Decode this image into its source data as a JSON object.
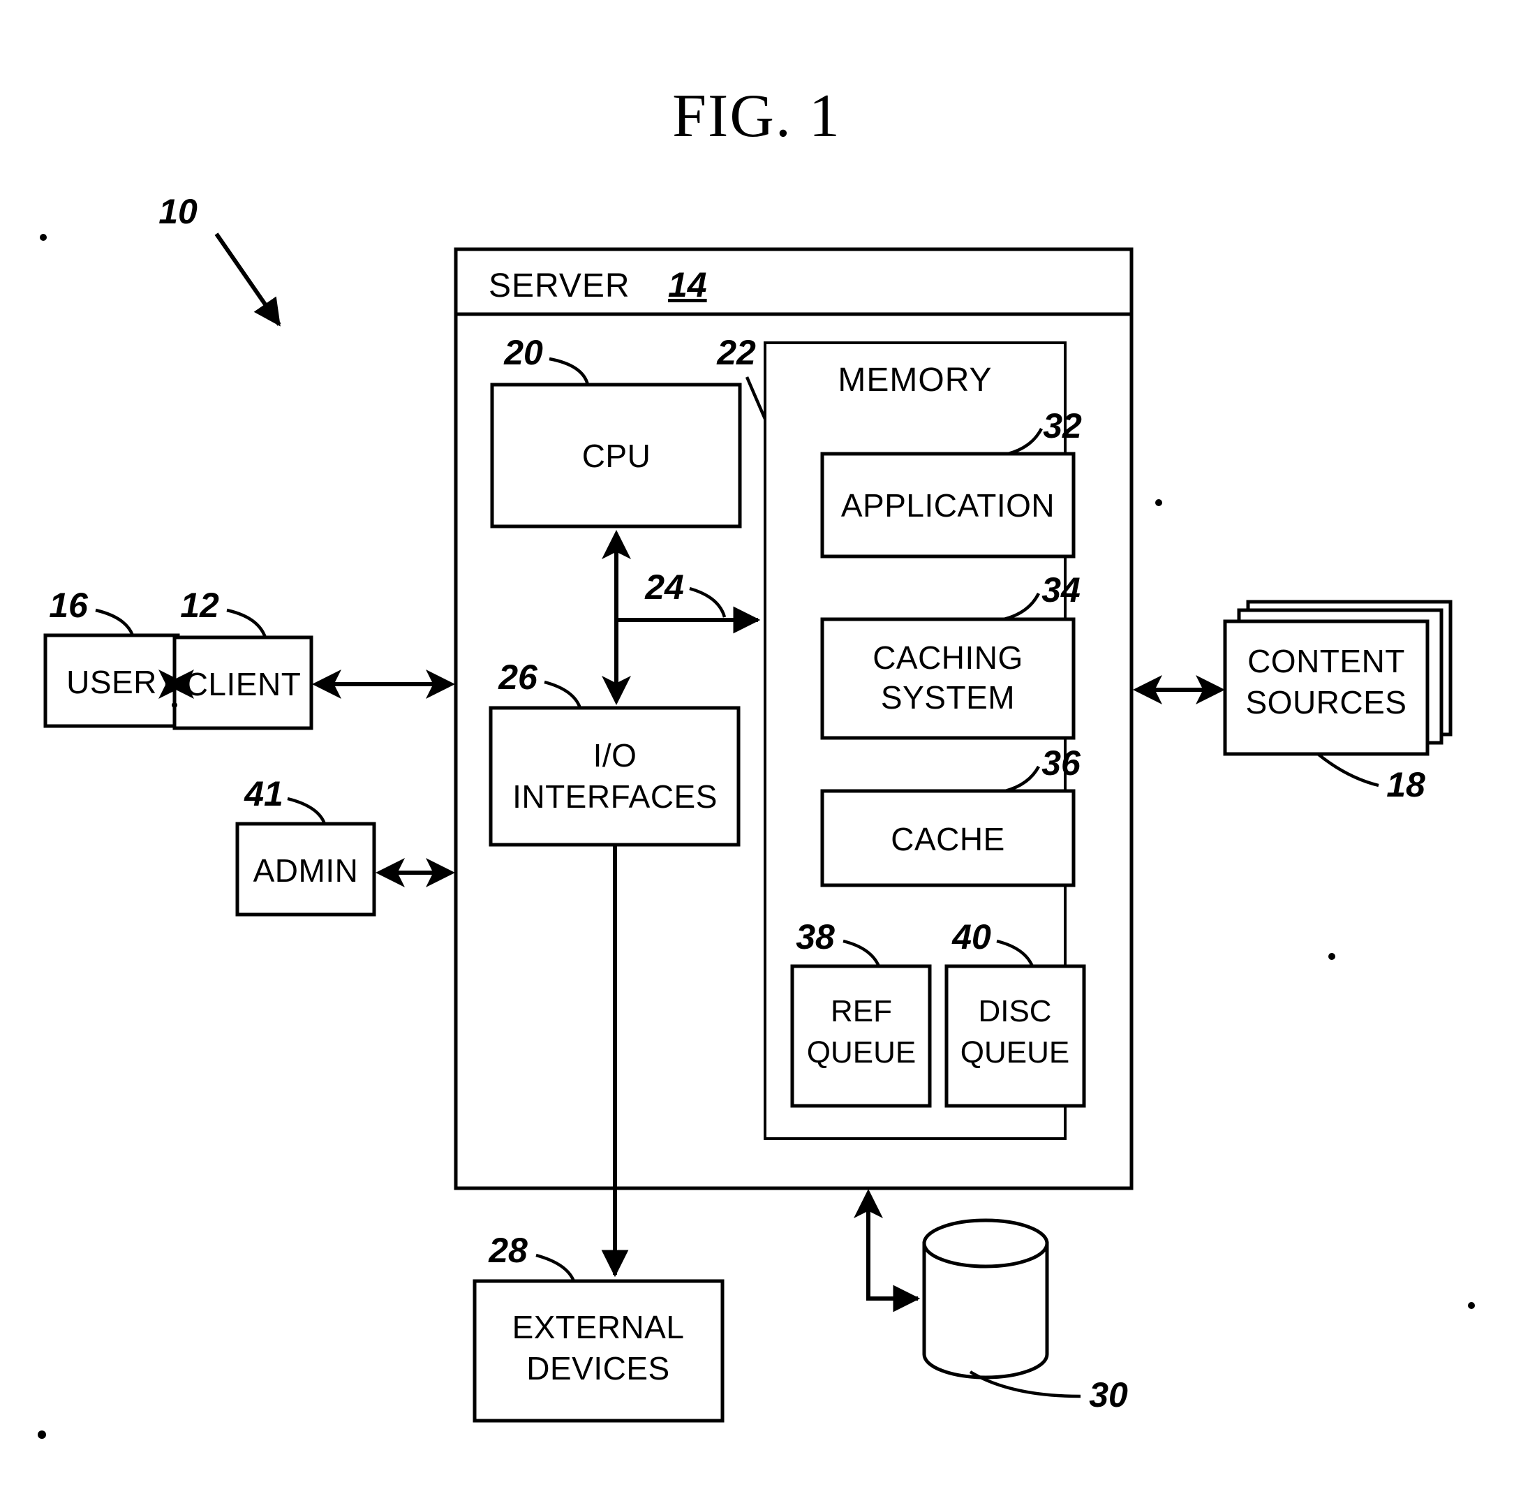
{
  "figure": {
    "title": "FIG. 1",
    "system_ref": "10"
  },
  "server": {
    "header_label": "SERVER",
    "header_ref": "14",
    "cpu": {
      "label": "CPU",
      "ref": "20"
    },
    "io": {
      "label_line1": "I/O",
      "label_line2": "INTERFACES",
      "ref": "26"
    },
    "bus_ref": "24",
    "memory": {
      "label": "MEMORY",
      "ref": "22",
      "blocks": [
        {
          "label": "APPLICATION",
          "ref": "32"
        },
        {
          "label_line1": "CACHING",
          "label_line2": "SYSTEM",
          "ref": "34"
        },
        {
          "label": "CACHE",
          "ref": "36"
        },
        {
          "label_line1": "REF",
          "label_line2": "QUEUE",
          "ref": "38"
        },
        {
          "label_line1": "DISC",
          "label_line2": "QUEUE",
          "ref": "40"
        }
      ]
    }
  },
  "external": {
    "user": {
      "label": "USER",
      "ref": "16"
    },
    "client": {
      "label": "CLIENT",
      "ref": "12"
    },
    "admin": {
      "label": "ADMIN",
      "ref": "41"
    },
    "content_sources": {
      "label_line1": "CONTENT",
      "label_line2": "SOURCES",
      "ref": "18"
    },
    "external_devices": {
      "label_line1": "EXTERNAL",
      "label_line2": "DEVICES",
      "ref": "28"
    },
    "storage": {
      "ref": "30",
      "icon": "cylinder-disk-icon"
    }
  },
  "colors": {
    "ink": "#000000",
    "paper": "#ffffff"
  }
}
